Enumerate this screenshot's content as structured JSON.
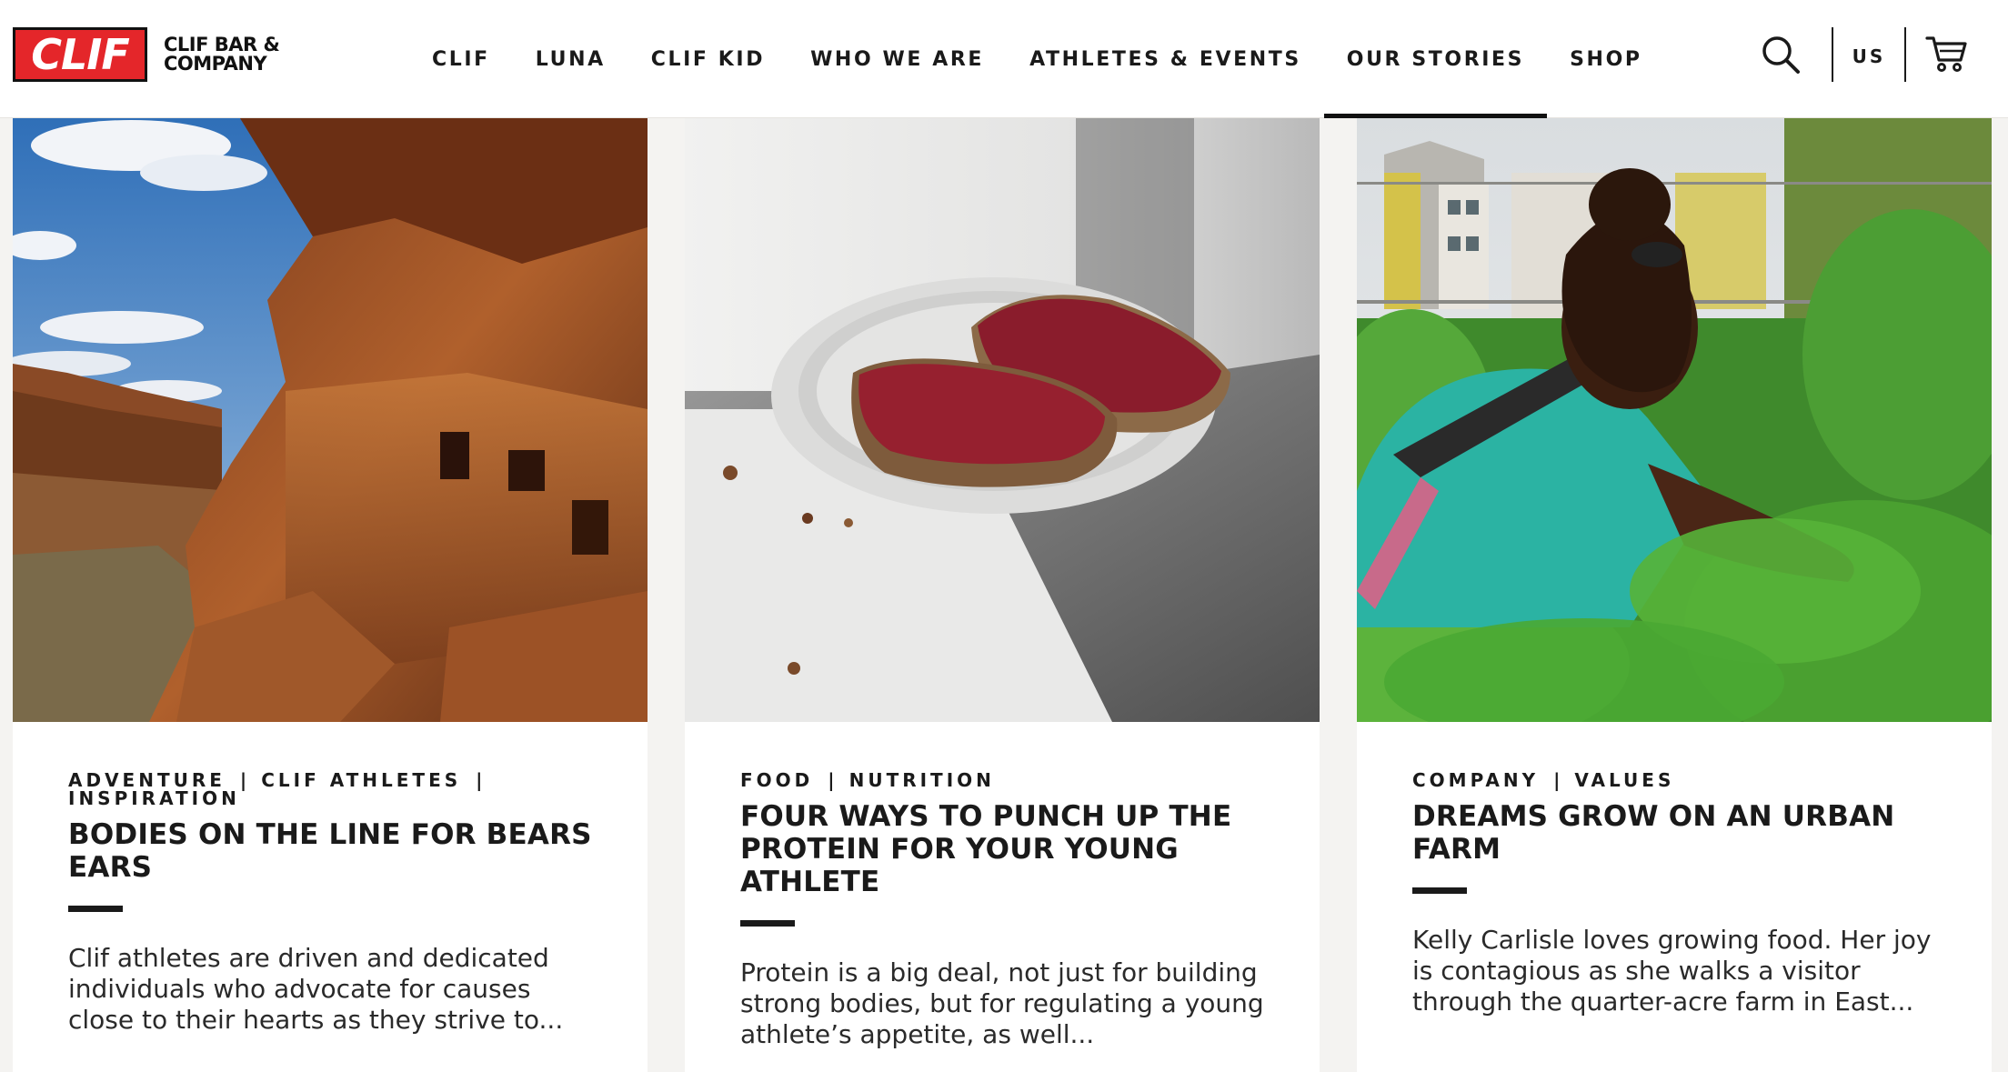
{
  "header": {
    "logo": {
      "mark": "CLIF",
      "company_lines": [
        "CLIF BAR &",
        "COMPANY"
      ]
    },
    "nav": [
      {
        "label": "CLIF",
        "active": false
      },
      {
        "label": "LUNA",
        "active": false
      },
      {
        "label": "CLIF KID",
        "active": false
      },
      {
        "label": "WHO WE ARE",
        "active": false
      },
      {
        "label": "ATHLETES & EVENTS",
        "active": false
      },
      {
        "label": "OUR STORIES",
        "active": true
      },
      {
        "label": "SHOP",
        "active": false
      }
    ],
    "search_icon": "search-icon",
    "region": "US",
    "cart_icon": "cart-icon"
  },
  "colors": {
    "brand_red": "#e4262a",
    "text_dark": "#1a1a1a",
    "page_bg": "#f4f3f1",
    "card_bg": "#ffffff"
  },
  "stories": [
    {
      "image": "canyon-cliff-dwelling",
      "tags": [
        "ADVENTURE",
        "CLIF ATHLETES",
        "INSPIRATION"
      ],
      "title": "BODIES ON THE LINE FOR BEARS EARS",
      "excerpt": "Clif athletes are driven and dedicated individuals who advocate for causes close to their hearts as they strive to..."
    },
    {
      "image": "toast-with-jam",
      "tags": [
        "FOOD",
        "NUTRITION"
      ],
      "title": "FOUR WAYS TO PUNCH UP THE PROTEIN FOR YOUR YOUNG ATHLETE",
      "excerpt": "Protein is a big deal, not just for building strong bodies, but for regulating a young athlete’s appetite, as well..."
    },
    {
      "image": "urban-farm-gardener",
      "tags": [
        "COMPANY",
        "VALUES"
      ],
      "title": "DREAMS GROW ON AN URBAN FARM",
      "excerpt": "Kelly Carlisle loves growing food. Her joy is contagious as she walks a visitor through the quarter-acre farm in East..."
    }
  ]
}
